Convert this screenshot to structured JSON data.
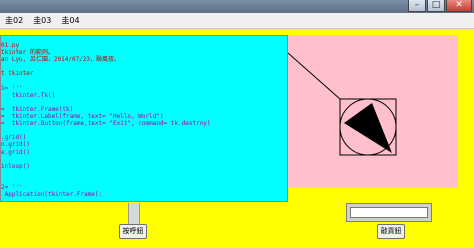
{
  "menu": [
    "圭02",
    "圭03",
    "圭04"
  ],
  "window_buttons": {
    "minimize": "–",
    "maximize": "□",
    "close": "✕"
  },
  "code_lines": [
    {
      "text": "01.py",
      "color": "#cc0000"
    },
    {
      "text": "tkinter 的範例。",
      "color": "#cc0000"
    },
    {
      "text": "an Lyu, 呂仁園，2014/07/23，颱風夜。",
      "color": "#cc0000"
    },
    {
      "text": "",
      "color": "#000000"
    },
    {
      "text": "t tkinter",
      "color": "#cc0000"
    },
    {
      "text": "",
      "color": "#000000"
    },
    {
      "text": "1= '''",
      "color": "#aa00aa"
    },
    {
      "text": "   tkinter.Tk()",
      "color": "#aa00aa"
    },
    {
      "text": "",
      "color": "#000000"
    },
    {
      "text": "=  tkinter.Frame(tk)",
      "color": "#aa00aa"
    },
    {
      "text": "=  tkinter.Label(frame, text= \"Hello, World\")",
      "color": "#aa00aa"
    },
    {
      "text": "=  tkinter.Button(frame,text= \"Exit\", command= tk.destroy)",
      "color": "#aa00aa"
    },
    {
      "text": "",
      "color": "#000000"
    },
    {
      "text": ".grid()",
      "color": "#aa00aa"
    },
    {
      "text": "n.grid()",
      "color": "#aa00aa"
    },
    {
      "text": "e.grid()",
      "color": "#aa00aa"
    },
    {
      "text": "",
      "color": "#000000"
    },
    {
      "text": "inloop()",
      "color": "#aa00aa"
    },
    {
      "text": "",
      "color": "#000000"
    },
    {
      "text": "",
      "color": "#000000"
    },
    {
      "text": "2= '''",
      "color": "#aa00aa"
    },
    {
      "text": " Application(tkinter.Frame):",
      "color": "#aa00aa"
    }
  ],
  "colors": {
    "background": "#ffff00",
    "code_bg": "#00ffff",
    "canvas_bg": "#ffc0cb"
  },
  "buttons": {
    "left": "按呼鈕",
    "right": "敲貢鈕"
  },
  "entry": {
    "value": ""
  }
}
